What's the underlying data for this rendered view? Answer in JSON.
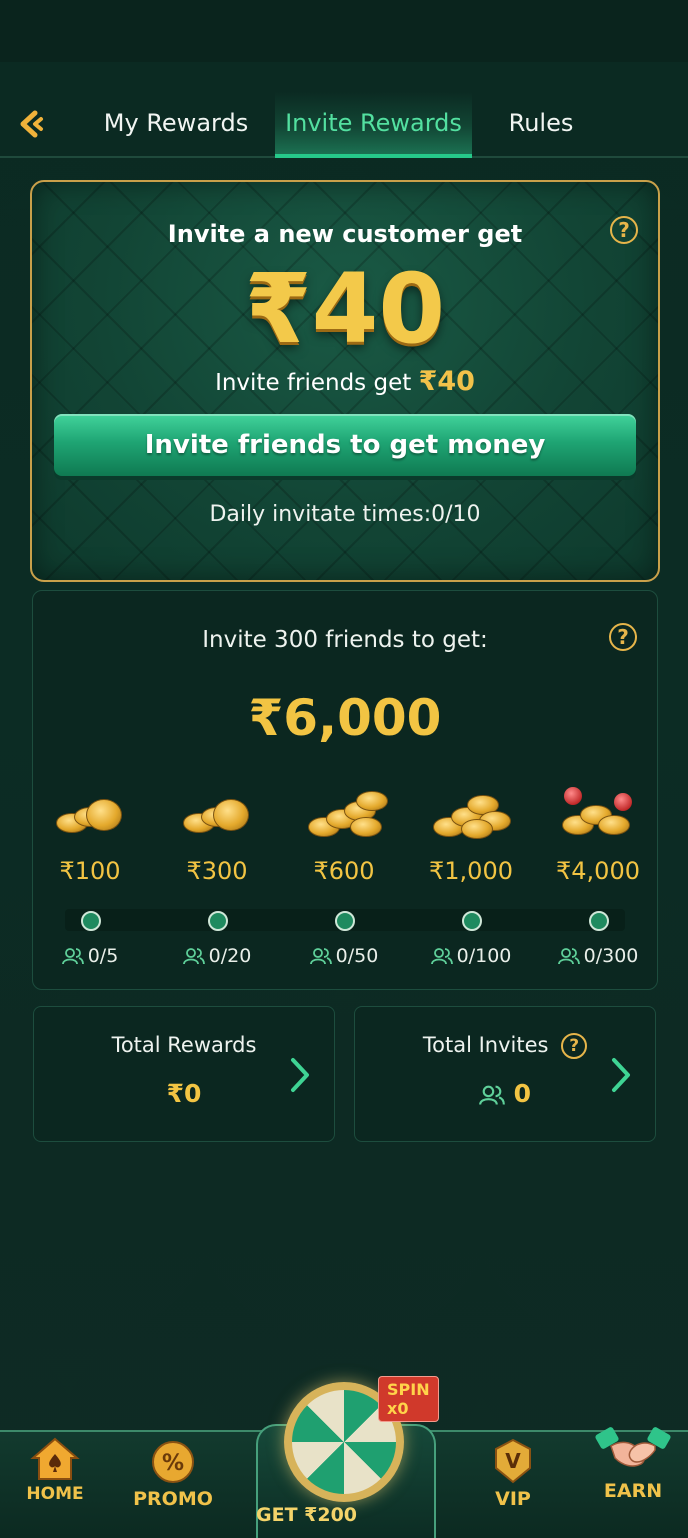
{
  "tabs": {
    "items": [
      {
        "label": "My Rewards"
      },
      {
        "label": "Invite Rewards"
      },
      {
        "label": "Rules"
      }
    ],
    "active": "Invite Rewards"
  },
  "invite_card": {
    "title": "Invite a new customer get",
    "amount": "₹40",
    "sub_label": "Invite friends get",
    "sub_amount": "₹40",
    "button_label": "Invite friends to get money",
    "daily_text": "Daily invitate times:0/10"
  },
  "milestones_card": {
    "title": "Invite 300 friends to get:",
    "amount": "₹6,000",
    "milestones": [
      {
        "value": "₹100",
        "count": "0/5"
      },
      {
        "value": "₹300",
        "count": "0/20"
      },
      {
        "value": "₹600",
        "count": "0/50"
      },
      {
        "value": "₹1,000",
        "count": "0/100"
      },
      {
        "value": "₹4,000",
        "count": "0/300"
      }
    ]
  },
  "totals": {
    "rewards_label": "Total Rewards",
    "rewards_value": "₹0",
    "invites_label": "Total Invites",
    "invites_value": "0"
  },
  "bottom_nav": {
    "home": "HOME",
    "promo": "PROMO",
    "get": "GET ₹200",
    "spin_badge": "SPIN x0",
    "vip": "VIP",
    "earn": "EARN"
  },
  "colors": {
    "accent_green": "#26c98a",
    "gold": "#f2c443",
    "background": "#0c2c24"
  }
}
